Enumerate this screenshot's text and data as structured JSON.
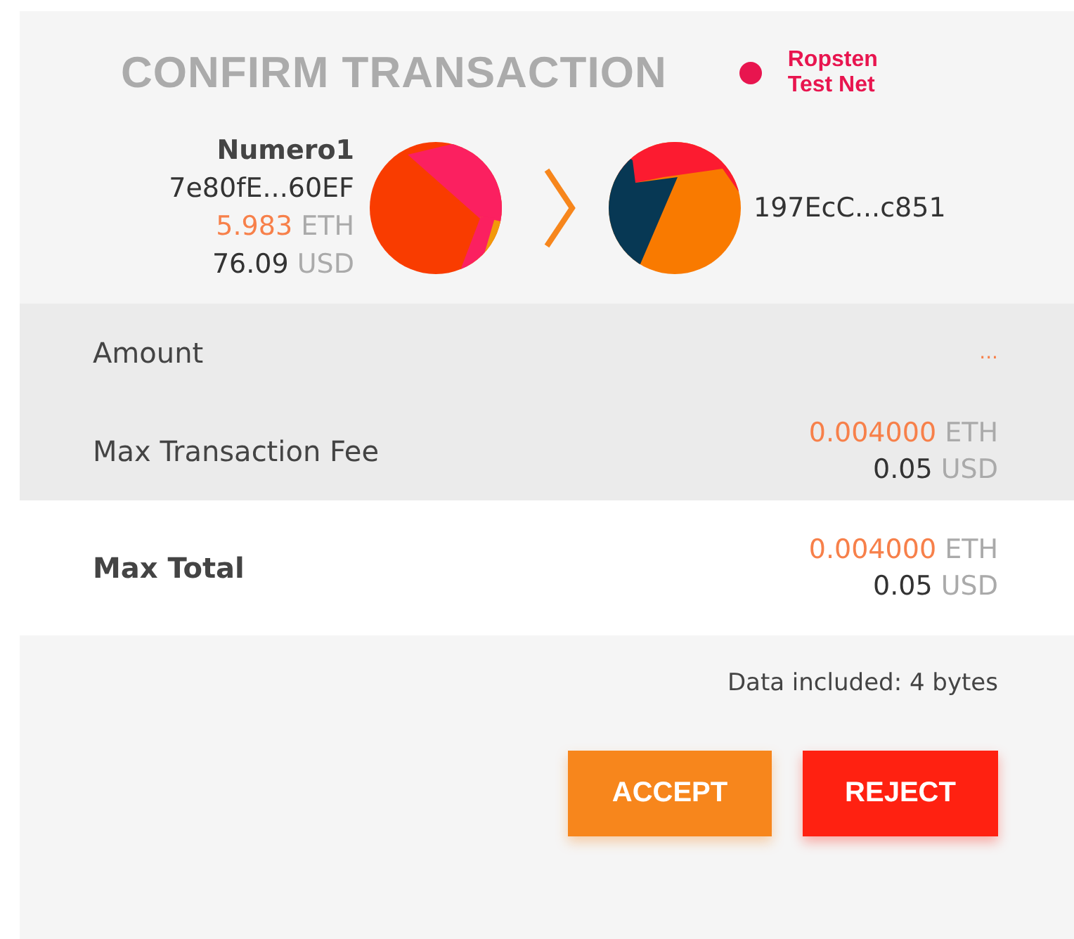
{
  "header": {
    "title": "CONFIRM TRANSACTION",
    "network": {
      "name": "Ropsten Test Net",
      "color": "#e8154f"
    }
  },
  "sender": {
    "name": "Numero1",
    "address": "7e80fE...60EF",
    "balance": {
      "amount": "5.983",
      "unit": "ETH"
    },
    "fiat": {
      "amount": "76.09",
      "unit": "USD"
    }
  },
  "recipient": {
    "address": "197EcC...c851"
  },
  "rows": [
    {
      "label": "Amount",
      "emphasis": false,
      "kind": "pending",
      "value": "..."
    },
    {
      "label": "Max Transaction Fee",
      "emphasis": false,
      "kind": "amount",
      "eth": {
        "amount": "0.004000",
        "unit": "ETH"
      },
      "fiat": {
        "amount": "0.05",
        "unit": "USD"
      }
    },
    {
      "label": "Max Total",
      "emphasis": true,
      "kind": "amount",
      "eth": {
        "amount": "0.004000",
        "unit": "ETH"
      },
      "fiat": {
        "amount": "0.05",
        "unit": "USD"
      }
    }
  ],
  "data_note": "Data included: 4 bytes",
  "buttons": [
    {
      "label": "ACCEPT",
      "kind": "accept"
    },
    {
      "label": "REJECT",
      "kind": "reject"
    }
  ]
}
